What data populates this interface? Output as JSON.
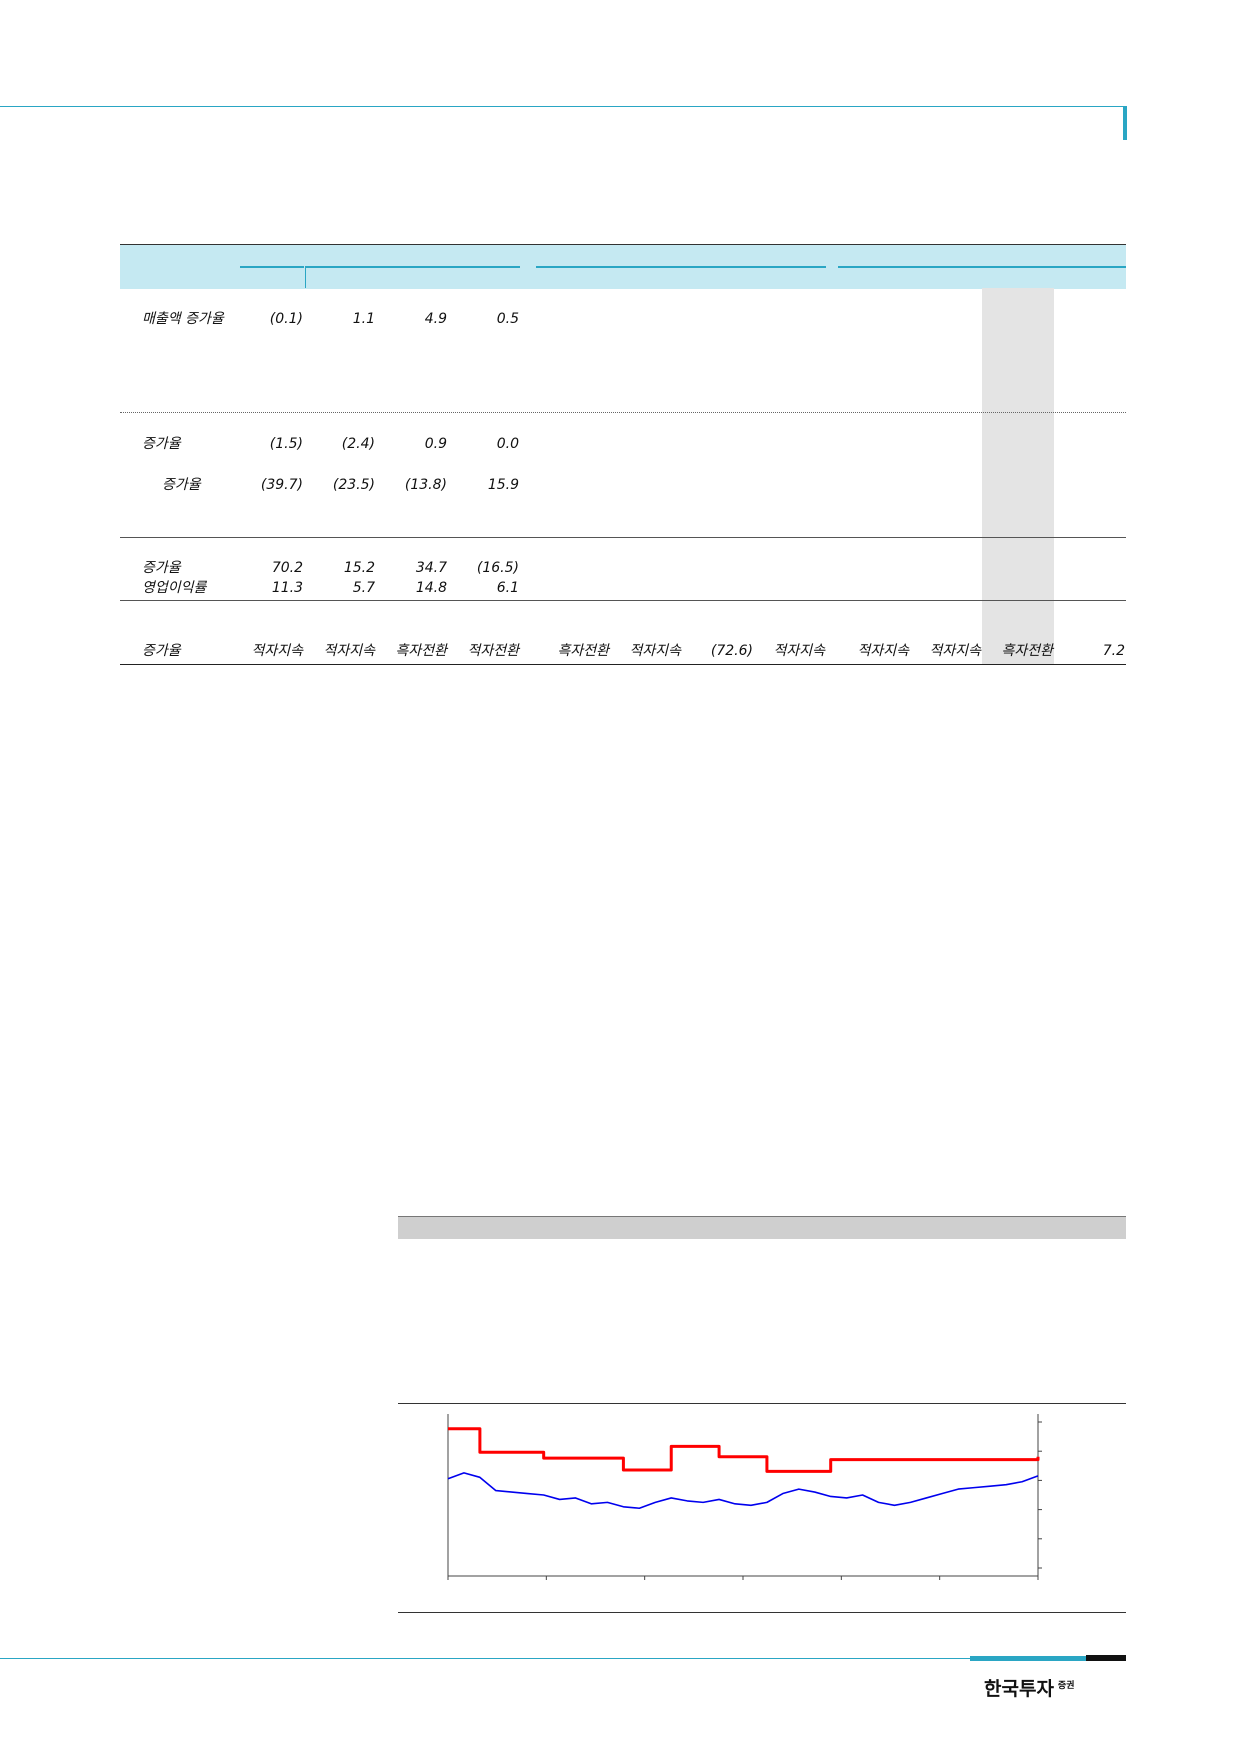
{
  "table": {
    "rows": [
      {
        "label": "매출액 증가율",
        "values": [
          "(0.1)",
          "1.1",
          "4.9",
          "0.5"
        ]
      },
      {
        "label": "증가율",
        "values": [
          "(1.5)",
          "(2.4)",
          "0.9",
          "0.0"
        ]
      },
      {
        "label": "증가율",
        "values": [
          "(39.7)",
          "(23.5)",
          "(13.8)",
          "15.9"
        ]
      },
      {
        "label": "증가율",
        "values": [
          "70.2",
          "15.2",
          "34.7",
          "(16.5)"
        ]
      },
      {
        "label": "영업이익률",
        "values": [
          "11.3",
          "5.7",
          "14.8",
          "6.1"
        ]
      },
      {
        "label": "증가율",
        "values": [
          "적자지속",
          "적자지속",
          "흑자전환",
          "적자전환",
          "흑자전환",
          "적자지속",
          "(72.6)",
          "적자지속",
          "적자지속",
          "적자지속",
          "흑자전환",
          "7.2"
        ]
      }
    ]
  },
  "chart_data": {
    "type": "line",
    "series": [
      {
        "values": [
          100,
          100,
          84,
          84,
          84,
          84,
          80,
          80,
          80,
          80,
          80,
          72,
          72,
          72,
          88,
          88,
          88,
          81,
          81,
          81,
          71,
          71,
          71,
          71,
          79,
          79,
          79,
          79,
          79,
          79,
          79,
          79,
          79,
          79,
          79,
          79,
          79,
          81
        ]
      },
      {
        "values": [
          66,
          70,
          67,
          58,
          57,
          56,
          55,
          52,
          53,
          49,
          50,
          47,
          46,
          50,
          53,
          51,
          50,
          52,
          49,
          48,
          50,
          56,
          59,
          57,
          54,
          53,
          55,
          50,
          48,
          50,
          53,
          56,
          59,
          60,
          61,
          62,
          64,
          68
        ]
      }
    ],
    "colors": [
      "#ff0000",
      "#0000ee"
    ]
  },
  "footer": {
    "logo_text": "한국투자",
    "logo_sub": "증권"
  }
}
